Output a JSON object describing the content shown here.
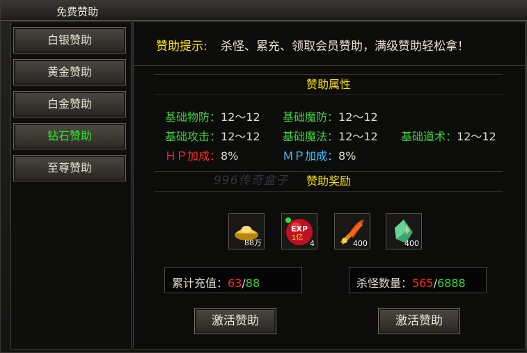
{
  "window": {
    "title": "免费赞助"
  },
  "nav": {
    "items": [
      {
        "label": "白银赞助"
      },
      {
        "label": "黄金赞助"
      },
      {
        "label": "白金赞助"
      },
      {
        "label": "钻石赞助",
        "active": true
      },
      {
        "label": "至尊赞助"
      }
    ]
  },
  "tip": {
    "label": "赞助提示:",
    "text": "杀怪、累充、领取会员赞助，满级赞助轻松拿！"
  },
  "attributes": {
    "heading": "赞助属性",
    "rows": [
      {
        "key": "基础物防：",
        "value": "12～12"
      },
      {
        "key": "基础魔防：",
        "value": "12～12"
      },
      {
        "key": "基础攻击：",
        "value": "12～12"
      },
      {
        "key": "基础魔法：",
        "value": "12～12"
      },
      {
        "key": "基础道术：",
        "value": "12～12"
      },
      {
        "key": "ＨＰ加成：",
        "value": "8%"
      },
      {
        "key": "ＭＰ加成：",
        "value": "8%"
      }
    ]
  },
  "watermark": "996传奇盒子",
  "rewards": {
    "heading": "赞助奖励",
    "items": [
      {
        "icon": "gold-ingot-icon",
        "count": "88万"
      },
      {
        "icon": "exp-orb-icon",
        "count": "4",
        "overlay_top": "EXP",
        "overlay_bottom": "1亿"
      },
      {
        "icon": "fire-sword-icon",
        "count": "400"
      },
      {
        "icon": "jade-stone-icon",
        "count": "400"
      }
    ]
  },
  "stats": {
    "recharge": {
      "label": "累计充值：",
      "current": "63",
      "sep": "/",
      "total": "88"
    },
    "kills": {
      "label": "杀怪数量：",
      "current": "565",
      "sep": "/",
      "total": "6888"
    }
  },
  "buttons": {
    "activate_1": "激活赞助",
    "activate_2": "激活赞助"
  },
  "colors": {
    "green": "#3fd13f",
    "yellow": "#ffe400",
    "red": "#ff2a1f",
    "cyan": "#3fc6ff"
  }
}
